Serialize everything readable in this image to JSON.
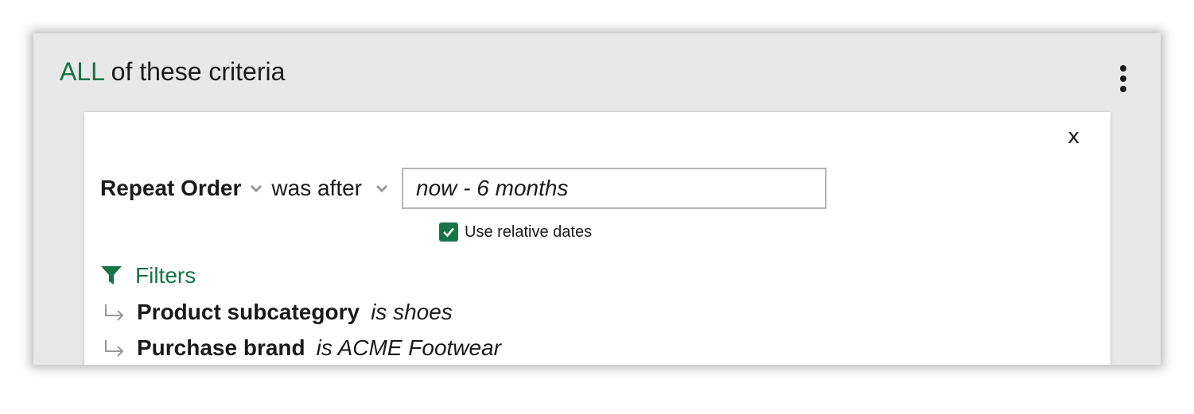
{
  "criteria": {
    "quantifier": "ALL",
    "title_suffix": " of these criteria",
    "menu_icon": "kebab-menu-icon"
  },
  "rule": {
    "close_label": "x",
    "field": "Repeat Order",
    "operator": "was after",
    "date_value": "now - 6 months",
    "relative_dates_label": "Use relative dates",
    "relative_dates_checked": true
  },
  "filters": {
    "heading": "Filters",
    "icon": "funnel-icon",
    "items": [
      {
        "field": "Product subcategory",
        "value": "is shoes"
      },
      {
        "field": "Purchase brand",
        "value": "is ACME Footwear"
      }
    ]
  },
  "colors": {
    "accent": "#17734a",
    "panel_bg": "#e8e8e8",
    "card_bg": "#ffffff",
    "text": "#1a1a1a",
    "muted_icon": "#999999"
  }
}
